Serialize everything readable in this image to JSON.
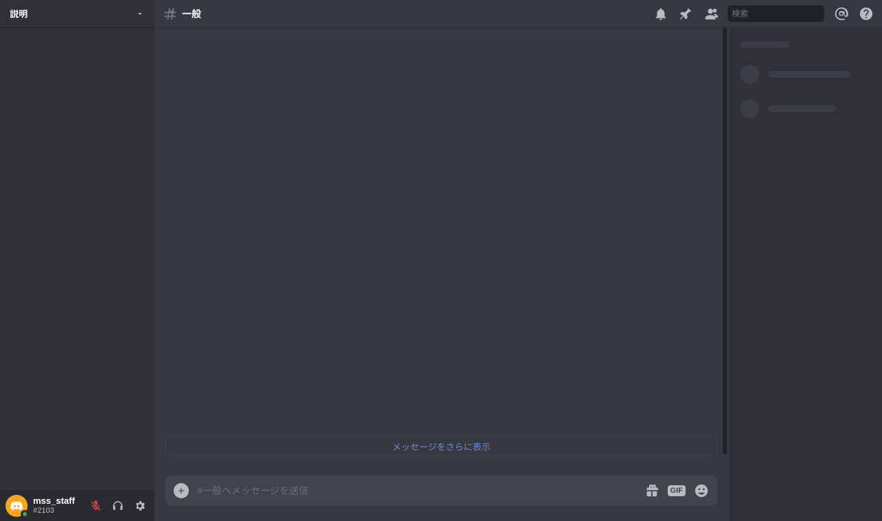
{
  "server": {
    "name": "説明"
  },
  "channel": {
    "name": "一般"
  },
  "header": {
    "search_placeholder": "検索"
  },
  "load_more_label": "メッセージをさらに表示",
  "composer": {
    "placeholder": "#一般へメッセージを送信",
    "gif_label": "GIF"
  },
  "user": {
    "name": "mss_staff",
    "tag": "#2103"
  }
}
